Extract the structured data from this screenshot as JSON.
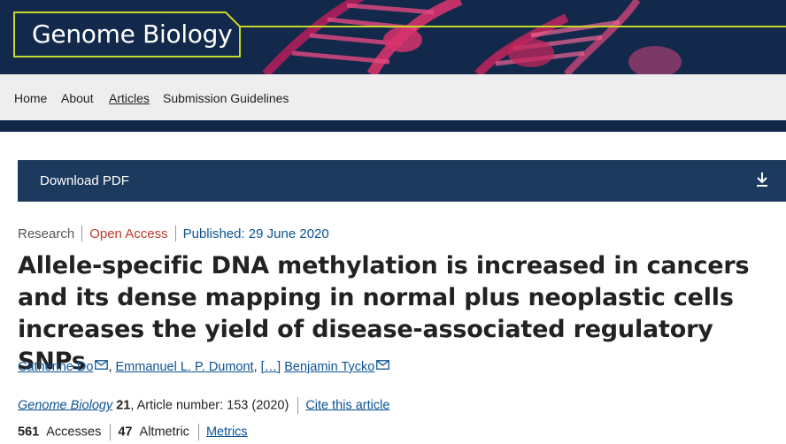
{
  "header": {
    "brand": "Genome Biology",
    "colors": {
      "navy": "#13294b",
      "accent_line": "#c6d82a",
      "dna": "#d6336c"
    }
  },
  "nav": {
    "items": [
      {
        "label": "Home"
      },
      {
        "label": "About"
      },
      {
        "label": "Articles"
      },
      {
        "label": "Submission Guidelines"
      }
    ],
    "active": "Articles"
  },
  "download": {
    "label": "Download PDF",
    "icon": "download-icon"
  },
  "meta": {
    "type": "Research",
    "access": "Open Access",
    "published": "Published: 29 June 2020"
  },
  "article": {
    "title": "Allele-specific DNA methylation is increased in cancers and its dense mapping in normal plus neoplastic cells increases the yield of disease-associated regulatory SNPs",
    "authors": {
      "first": "Catherine Do",
      "second": "Emmanuel L. P. Dumont",
      "ellipsis": "[…]",
      "last": "Benjamin Tycko"
    }
  },
  "citation": {
    "journal": "Genome Biology",
    "volume": "21",
    "rest": ", Article number: 153 (2020)",
    "cite_link": "Cite this article"
  },
  "metrics": {
    "accesses_count": "561",
    "accesses_label": "Accesses",
    "altmetric_count": "47",
    "altmetric_label": "Altmetric",
    "metrics_link": "Metrics"
  }
}
